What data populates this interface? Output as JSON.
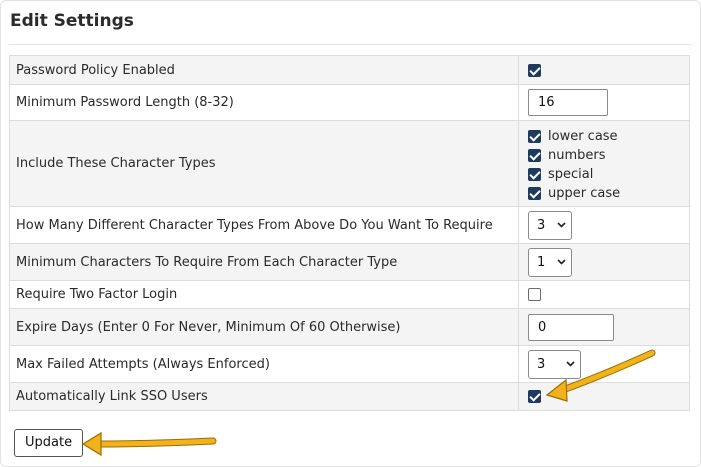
{
  "panel": {
    "title": "Edit Settings"
  },
  "settings": {
    "password_policy": {
      "label": "Password Policy Enabled",
      "checked": true
    },
    "min_length": {
      "label": "Minimum Password Length (8-32)",
      "value": "16"
    },
    "char_types": {
      "label": "Include These Character Types",
      "options": [
        {
          "label": "lower case",
          "checked": true
        },
        {
          "label": "numbers",
          "checked": true
        },
        {
          "label": "special",
          "checked": true
        },
        {
          "label": "upper case",
          "checked": true
        }
      ]
    },
    "require_types": {
      "label": "How Many Different Character Types From Above Do You Want To Require",
      "value": "3"
    },
    "min_each": {
      "label": "Minimum Characters To Require From Each Character Type",
      "value": "1"
    },
    "two_factor": {
      "label": "Require Two Factor Login",
      "checked": false
    },
    "expire_days": {
      "label": "Expire Days (Enter 0 For Never, Minimum Of 60 Otherwise)",
      "value": "0"
    },
    "max_failed": {
      "label": "Max Failed Attempts (Always Enforced)",
      "value": "3"
    },
    "link_sso": {
      "label": "Automatically Link SSO Users",
      "checked": true
    }
  },
  "actions": {
    "update_label": "Update"
  },
  "annotations": {
    "arrow_color": "#f2b21b",
    "arrow_outline": "#9a6e00"
  }
}
